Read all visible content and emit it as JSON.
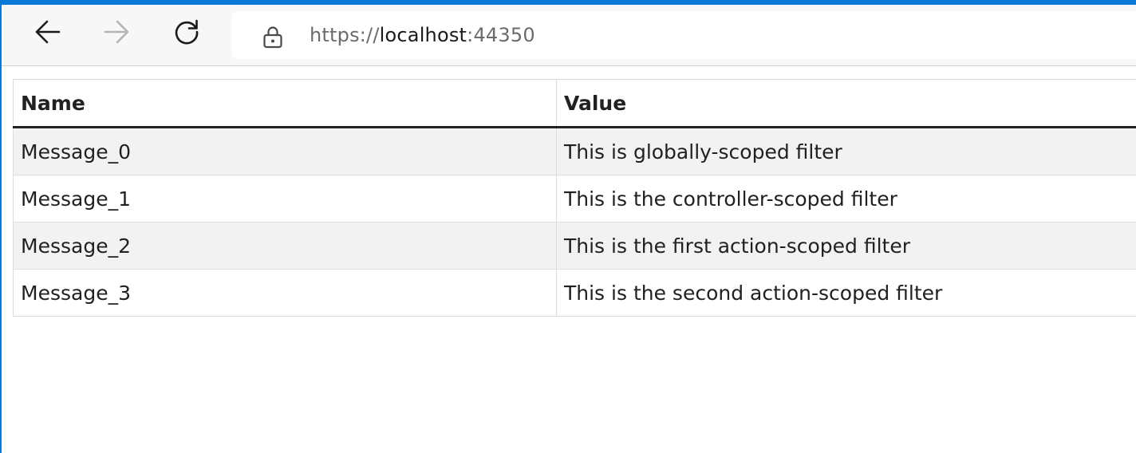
{
  "browser": {
    "url": {
      "scheme": "https://",
      "host": "localhost",
      "port": ":44350"
    },
    "icons": {
      "back": "back-arrow-icon",
      "forward": "forward-arrow-icon",
      "refresh": "refresh-icon",
      "lock": "lock-icon"
    },
    "colors": {
      "frame_accent": "#0a78d7",
      "forward_disabled": "#b5b5b5"
    }
  },
  "table": {
    "headers": {
      "name": "Name",
      "value": "Value"
    },
    "rows": [
      {
        "name": "Message_0",
        "value": "This is globally-scoped filter"
      },
      {
        "name": "Message_1",
        "value": "This is the controller-scoped filter"
      },
      {
        "name": "Message_2",
        "value": "This is the first action-scoped filter"
      },
      {
        "name": "Message_3",
        "value": "This is the second action-scoped filter"
      }
    ]
  }
}
